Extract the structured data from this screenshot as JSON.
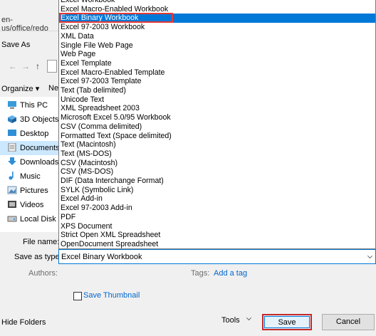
{
  "browser": {
    "url_fragment": "en-us/office/redo"
  },
  "dialog": {
    "title": "Save As",
    "nav_back": "←",
    "nav_forward": "→",
    "nav_up": "↑",
    "organize_label": "Organize ▾",
    "new_folder_label": "Ne",
    "tree": [
      {
        "label": "This PC",
        "icon": "computer-icon",
        "selected": false
      },
      {
        "label": "3D Objects",
        "icon": "cube-icon",
        "selected": false
      },
      {
        "label": "Desktop",
        "icon": "desktop-icon",
        "selected": false
      },
      {
        "label": "Documents",
        "icon": "document-icon",
        "selected": true
      },
      {
        "label": "Downloads",
        "icon": "download-icon",
        "selected": false
      },
      {
        "label": "Music",
        "icon": "music-icon",
        "selected": false
      },
      {
        "label": "Pictures",
        "icon": "picture-icon",
        "selected": false
      },
      {
        "label": "Videos",
        "icon": "video-icon",
        "selected": false
      },
      {
        "label": "Local Disk (C",
        "icon": "drive-icon",
        "selected": false
      }
    ],
    "file_name_label": "File name:",
    "file_name_value": "",
    "save_as_type_label": "Save as type:",
    "save_as_type_value": "Excel Binary Workbook",
    "authors_label": "Authors:",
    "tags_label": "Tags:",
    "tags_value": "Add a tag",
    "save_thumbnail_label": "Save Thumbnail",
    "hide_folders_label": "Hide Folders",
    "tools_label": "Tools",
    "save_button": "Save",
    "cancel_button": "Cancel"
  },
  "file_types": [
    "Excel Workbook",
    "Excel Macro-Enabled Workbook",
    "Excel Binary Workbook",
    "Excel 97-2003 Workbook",
    "XML Data",
    "Single File Web Page",
    "Web Page",
    "Excel Template",
    "Excel Macro-Enabled Template",
    "Excel 97-2003 Template",
    "Text (Tab delimited)",
    "Unicode Text",
    "XML Spreadsheet 2003",
    "Microsoft Excel 5.0/95 Workbook",
    "CSV (Comma delimited)",
    "Formatted Text (Space delimited)",
    "Text (Macintosh)",
    "Text (MS-DOS)",
    "CSV (Macintosh)",
    "CSV (MS-DOS)",
    "DIF (Data Interchange Format)",
    "SYLK (Symbolic Link)",
    "Excel Add-in",
    "Excel 97-2003 Add-in",
    "PDF",
    "XPS Document",
    "Strict Open XML Spreadsheet",
    "OpenDocument Spreadsheet"
  ],
  "highlighted_type": "Excel Binary Workbook",
  "colors": {
    "accent": "#0078d7",
    "highlight_border": "#e53935",
    "link": "#0066cc"
  }
}
